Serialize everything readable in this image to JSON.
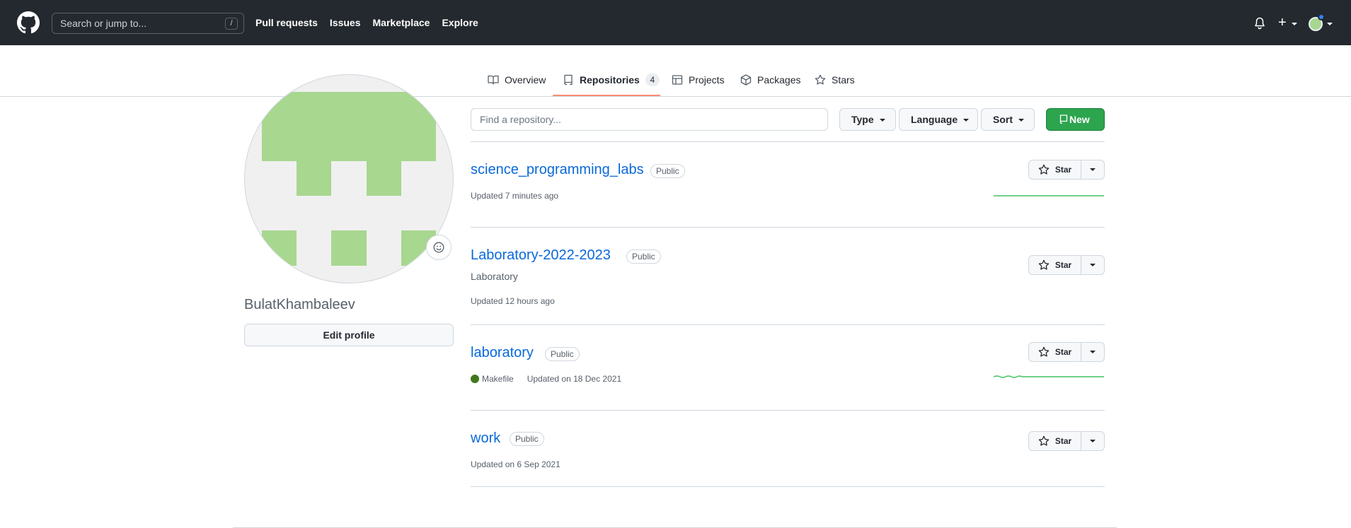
{
  "header": {
    "search_placeholder": "Search or jump to...",
    "search_shortcut": "/",
    "nav": [
      "Pull requests",
      "Issues",
      "Marketplace",
      "Explore"
    ]
  },
  "tabs": [
    {
      "label": "Overview",
      "icon": "book-icon"
    },
    {
      "label": "Repositories",
      "icon": "repo-icon",
      "count": "4",
      "selected": true
    },
    {
      "label": "Projects",
      "icon": "table-icon"
    },
    {
      "label": "Packages",
      "icon": "package-icon"
    },
    {
      "label": "Stars",
      "icon": "star-icon"
    }
  ],
  "profile": {
    "username": "BulatKhambaleev",
    "edit_label": "Edit profile"
  },
  "toolbar": {
    "find_placeholder": "Find a repository...",
    "type_label": "Type",
    "language_label": "Language",
    "sort_label": "Sort",
    "new_label": "New"
  },
  "repos": [
    {
      "name": "science_programming_labs",
      "visibility": "Public",
      "description": "",
      "language": "",
      "updated": "Updated 7 minutes ago",
      "star_label": "Star"
    },
    {
      "name": "Laboratory-2022-2023",
      "visibility": "Public",
      "description": "Laboratory",
      "language": "",
      "updated": "Updated 12 hours ago",
      "star_label": "Star"
    },
    {
      "name": "laboratory",
      "visibility": "Public",
      "description": "",
      "language": "Makefile",
      "updated": "Updated on 18 Dec 2021",
      "star_label": "Star"
    },
    {
      "name": "work",
      "visibility": "Public",
      "description": "",
      "language": "",
      "updated": "Updated on 6 Sep 2021",
      "star_label": "Star"
    }
  ],
  "colors": {
    "header_bg": "#24292f",
    "link": "#0969da",
    "new_button": "#2da44e",
    "tab_underline": "#fd8c73",
    "avatar_identicon": "#a8d78f",
    "makefile_lang": "#427819"
  }
}
